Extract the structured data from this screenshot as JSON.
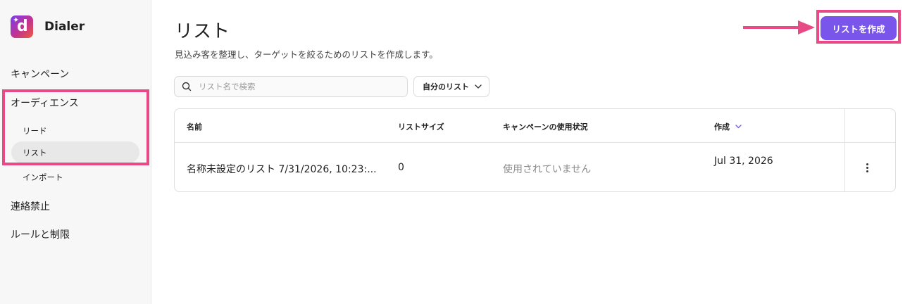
{
  "app": {
    "name": "Dialer",
    "logo_letter": "d",
    "logo_gradient": [
      "#7b3cf0",
      "#c2348f",
      "#f05a3a"
    ]
  },
  "sidebar": {
    "items": [
      {
        "label": "キャンペーン"
      },
      {
        "label": "オーディエンス",
        "children": [
          {
            "label": "リード"
          },
          {
            "label": "リスト",
            "active": true
          },
          {
            "label": "インポート"
          }
        ]
      },
      {
        "label": "連絡禁止"
      },
      {
        "label": "ルールと制限"
      }
    ]
  },
  "header": {
    "title": "リスト",
    "description": "見込み客を整理し、ターゲットを絞るためのリストを作成します。",
    "create_button": "リストを作成"
  },
  "search": {
    "placeholder": "リスト名で検索",
    "icon": "search-icon"
  },
  "filter": {
    "label": "自分のリスト",
    "icon": "chevron-down-icon"
  },
  "table": {
    "columns": [
      "名前",
      "リストサイズ",
      "キャンペーンの使用状況",
      "作成"
    ],
    "sort_icon": "chevron-down-icon",
    "rows": [
      {
        "name": "名称未設定のリスト 7/31/2026, 10:23:...",
        "size": "0",
        "usage": "使用されていません",
        "created": "Jul 31, 2026",
        "menu_icon": "kebab-icon"
      }
    ]
  },
  "annotations": {
    "highlight_color": "#e84a86",
    "arrow_icon": "arrow-right-icon"
  },
  "colors": {
    "accent": "#7a55ec",
    "sidebar_bg": "#f7f7f7",
    "active_item_bg": "#e8e8e8"
  }
}
